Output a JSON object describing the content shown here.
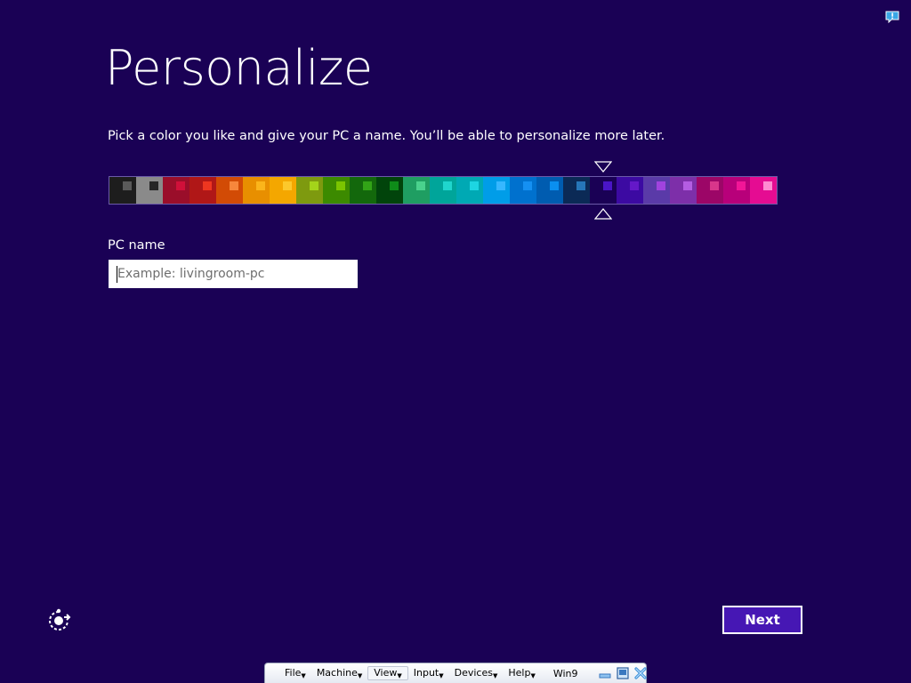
{
  "header": {
    "title": "Personalize"
  },
  "instructions": "Pick a color you like and give your PC a name. You’ll be able to personalize more later.",
  "color_palette": {
    "selected_index": 18,
    "swatches": [
      {
        "bg": "#1d1d1d",
        "dot": "#5a5a5a"
      },
      {
        "bg": "#8a8a8a",
        "dot": "#262626"
      },
      {
        "bg": "#9a0e2a",
        "dot": "#d0103a"
      },
      {
        "bg": "#b01717",
        "dot": "#ee3620"
      },
      {
        "bg": "#d24b05",
        "dot": "#f7873c"
      },
      {
        "bg": "#e88f00",
        "dot": "#fbb51b"
      },
      {
        "bg": "#f4a700",
        "dot": "#fcc82c"
      },
      {
        "bg": "#7e9a0f",
        "dot": "#a4d41a"
      },
      {
        "bg": "#3c8a00",
        "dot": "#7bc400"
      },
      {
        "bg": "#13680c",
        "dot": "#32a317"
      },
      {
        "bg": "#01440b",
        "dot": "#0e8c19"
      },
      {
        "bg": "#1f9e62",
        "dot": "#4ad28d"
      },
      {
        "bg": "#00a59a",
        "dot": "#1fd6cd"
      },
      {
        "bg": "#00a9b4",
        "dot": "#1dd5e2"
      },
      {
        "bg": "#009de8",
        "dot": "#36b7ff"
      },
      {
        "bg": "#0071ce",
        "dot": "#1590f2"
      },
      {
        "bg": "#005cb0",
        "dot": "#0a8ff0"
      },
      {
        "bg": "#0b2a56",
        "dot": "#2676b8"
      },
      {
        "bg": "#1a0155",
        "dot": "#4a15c6"
      },
      {
        "bg": "#3c0aa2",
        "dot": "#6418c8"
      },
      {
        "bg": "#5a3aa8",
        "dot": "#a043de"
      },
      {
        "bg": "#7d2fa9",
        "dot": "#b45de2"
      },
      {
        "bg": "#9c0667",
        "dot": "#d9368b"
      },
      {
        "bg": "#b8007a",
        "dot": "#f21697"
      },
      {
        "bg": "#e50c92",
        "dot": "#ff8ad1"
      }
    ]
  },
  "pc_name": {
    "label": "PC name",
    "placeholder": "Example: livingroom-pc",
    "value": ""
  },
  "next_button": {
    "label": "Next"
  },
  "colors": {
    "background": "#1a0155",
    "accent_button": "#4617b4"
  },
  "icons": {
    "top_right": "feedback-icon",
    "bottom_left": "ease-of-access-icon"
  },
  "vbox_bar": {
    "menus": [
      "File",
      "Machine",
      "View",
      "Input",
      "Devices",
      "Help"
    ],
    "active_menu": "View",
    "vm_name": "Win9"
  }
}
